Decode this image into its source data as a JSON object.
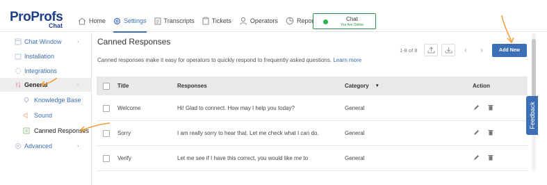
{
  "logo": {
    "main_left": "Pro",
    "main_right": "Profs",
    "sub": "Chat"
  },
  "nav": [
    {
      "label": "Home",
      "icon": "home-icon"
    },
    {
      "label": "Settings",
      "icon": "gear-icon"
    },
    {
      "label": "Transcripts",
      "icon": "document-icon"
    },
    {
      "label": "Tickets",
      "icon": "clipboard-icon"
    },
    {
      "label": "Operators",
      "icon": "user-icon"
    },
    {
      "label": "Reports",
      "icon": "pie-chart-icon"
    }
  ],
  "chat_status": {
    "title": "Chat",
    "status": "You Are Online",
    "color": "#2eb34a"
  },
  "sidebar": {
    "items": [
      {
        "label": "Chat Window",
        "icon": "window-icon"
      },
      {
        "label": "Installation",
        "icon": "install-icon"
      },
      {
        "label": "Integrations",
        "icon": "puzzle-icon"
      },
      {
        "label": "General",
        "icon": "sliders-icon"
      },
      {
        "label": "Knowledge Base",
        "icon": "bulb-icon"
      },
      {
        "label": "Sound",
        "icon": "speaker-icon"
      },
      {
        "label": "Canned Responses",
        "icon": "chat-list-icon"
      },
      {
        "label": "Advanced",
        "icon": "gear-icon"
      }
    ]
  },
  "main": {
    "title": "Canned Responses",
    "description": "Canned responses make it easy for operators to quickly respond to frequently asked questions.",
    "learn_more": "Learn more",
    "pager": "1-8 of 8",
    "add_button": "Add New"
  },
  "table": {
    "headers": {
      "title": "Title",
      "responses": "Responses",
      "category": "Category",
      "action": "Action"
    },
    "rows": [
      {
        "title": "Welcome",
        "response": "Hi! Glad to connect. How may I help you today?",
        "category": "General"
      },
      {
        "title": "Sorry",
        "response": "I am really sorry to hear that. Let me check what I can do.",
        "category": "General"
      },
      {
        "title": "Verify",
        "response": "Let me see if I have this correct, you would like me to",
        "category": "General"
      }
    ]
  },
  "feedback": {
    "label": "Feedback"
  },
  "colors": {
    "accent": "#3d6fb6",
    "annotation": "#f29a38",
    "online": "#2eb34a"
  }
}
